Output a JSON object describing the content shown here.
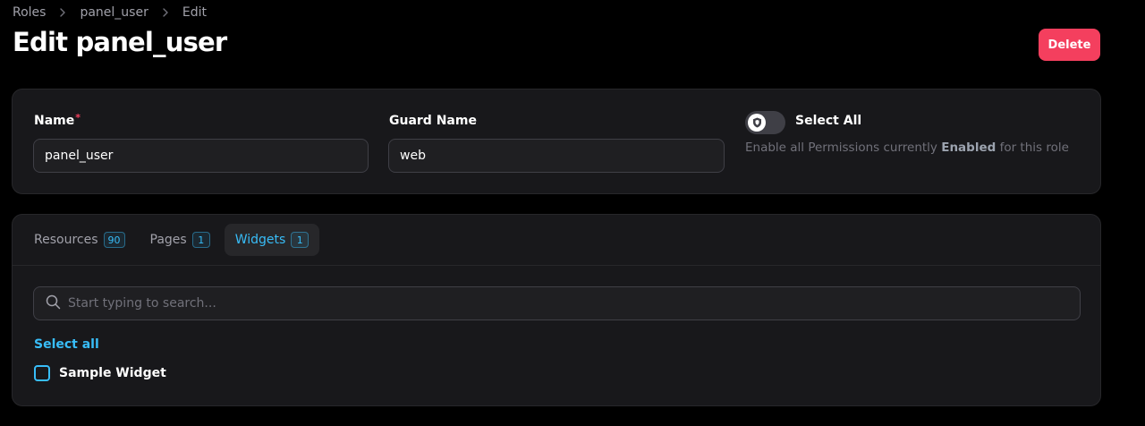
{
  "breadcrumb": {
    "items": [
      "Roles",
      "panel_user",
      "Edit"
    ]
  },
  "page": {
    "title": "Edit panel_user",
    "delete_label": "Delete"
  },
  "form": {
    "name_label": "Name",
    "name_required_mark": "*",
    "name_value": "panel_user",
    "guard_label": "Guard Name",
    "guard_value": "web",
    "select_all_label": "Select All",
    "select_all_desc_prefix": "Enable all Permissions currently ",
    "select_all_desc_bold": "Enabled",
    "select_all_desc_suffix": " for this role"
  },
  "tabs": [
    {
      "label": "Resources",
      "count": "90",
      "active": false
    },
    {
      "label": "Pages",
      "count": "1",
      "active": false
    },
    {
      "label": "Widgets",
      "count": "1",
      "active": true
    }
  ],
  "permissions": {
    "search_placeholder": "Start typing to search...",
    "select_all_link": "Select all",
    "items": [
      {
        "label": "Sample Widget",
        "checked": false
      }
    ]
  },
  "colors": {
    "accent": "#38bdf8",
    "danger": "#f43f5e",
    "background": "#000000",
    "card": "#18181b"
  },
  "icons": [
    "chevron-right-icon",
    "shield-icon",
    "search-icon"
  ]
}
